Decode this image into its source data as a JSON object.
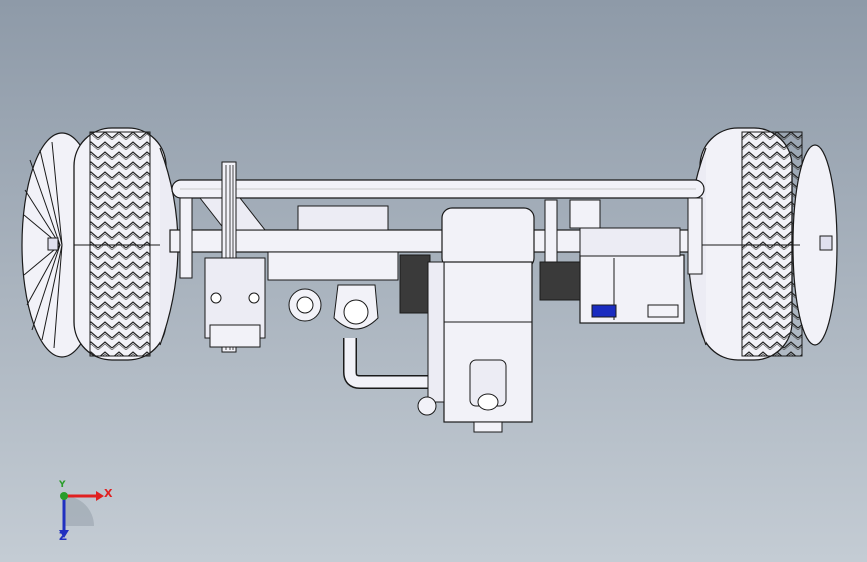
{
  "viewport": {
    "background_top": "#8e9aa8",
    "background_bottom": "#c4ccd4",
    "model_edge_color": "#1a1a1a",
    "model_fill_color": "#f2f2f8",
    "shadow_color": "#3a3a3a",
    "accent_blue": "#1a2cc0"
  },
  "triad": {
    "x_label": "X",
    "y_label": "Y",
    "z_label": "Z",
    "x_color": "#e02020",
    "y_color": "#2a9d2a",
    "z_color": "#2030c0"
  }
}
